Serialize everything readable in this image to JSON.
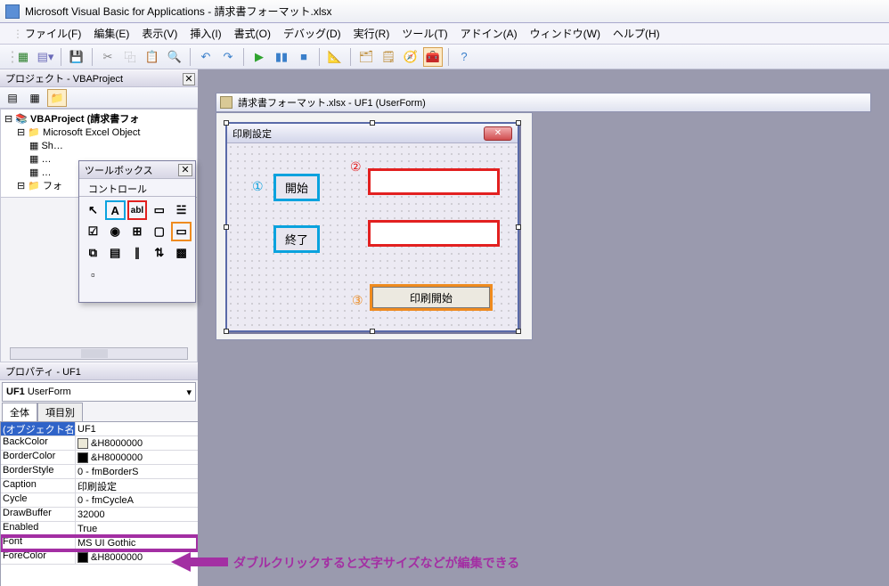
{
  "app": {
    "title": "Microsoft Visual Basic for Applications - 請求書フォーマット.xlsx"
  },
  "menu": {
    "file": "ファイル(F)",
    "edit": "編集(E)",
    "view": "表示(V)",
    "insert": "挿入(I)",
    "format": "書式(O)",
    "debug": "デバッグ(D)",
    "run": "実行(R)",
    "tools": "ツール(T)",
    "addins": "アドイン(A)",
    "window": "ウィンドウ(W)",
    "help": "ヘルプ(H)"
  },
  "project_panel": {
    "title": "プロジェクト - VBAProject",
    "root": "VBAProject (請求書フォ",
    "objs": "Microsoft Excel Object",
    "forms": "フォ"
  },
  "toolbox": {
    "title": "ツールボックス",
    "tab": "コントロール"
  },
  "mdi": {
    "title": "請求書フォーマット.xlsx - UF1 (UserForm)"
  },
  "userform": {
    "caption": "印刷設定",
    "label_start": "開始",
    "label_end": "終了",
    "btn_print": "印刷開始"
  },
  "annot": {
    "n1": "①",
    "n2": "②",
    "n3": "③"
  },
  "properties": {
    "panel_title": "プロパティ - UF1",
    "combo": "UF1 UserForm",
    "tab_all": "全体",
    "tab_cat": "項目別",
    "rows": [
      {
        "k": "(オブジェクト名)",
        "v": "UF1",
        "sel": true
      },
      {
        "k": "BackColor",
        "v": "&H8000000",
        "sw": "#ece9d8"
      },
      {
        "k": "BorderColor",
        "v": "&H8000000",
        "sw": "#000000"
      },
      {
        "k": "BorderStyle",
        "v": "0 - fmBorderS"
      },
      {
        "k": "Caption",
        "v": "印刷設定"
      },
      {
        "k": "Cycle",
        "v": "0 - fmCycleA"
      },
      {
        "k": "DrawBuffer",
        "v": "32000"
      },
      {
        "k": "Enabled",
        "v": "True"
      },
      {
        "k": "Font",
        "v": "MS UI Gothic",
        "hl": true
      },
      {
        "k": "ForeColor",
        "v": "&H8000000",
        "sw": "#000000"
      }
    ]
  },
  "tip": "ダブルクリックすると文字サイズなどが編集できる"
}
